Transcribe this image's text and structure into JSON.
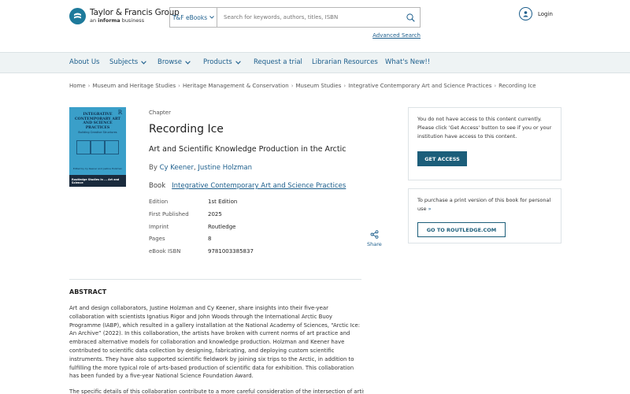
{
  "header": {
    "logo_main": "Taylor & Francis Group",
    "logo_sub_prefix": "an ",
    "logo_sub_bold": "informa",
    "logo_sub_suffix": " business",
    "search_scope": "T&F eBooks",
    "search_placeholder": "Search for keywords, authors, titles, ISBN",
    "advanced_search": "Advanced Search",
    "login": "Login"
  },
  "nav": {
    "items": [
      {
        "label": "About Us",
        "dropdown": false
      },
      {
        "label": "Subjects",
        "dropdown": true
      },
      {
        "label": "Browse",
        "dropdown": true
      },
      {
        "label": "Products",
        "dropdown": true
      },
      {
        "label": "Request a trial",
        "dropdown": false
      },
      {
        "label": "Librarian Resources",
        "dropdown": false
      },
      {
        "label": "What's New!!",
        "dropdown": false
      }
    ]
  },
  "breadcrumb": [
    "Home",
    "Museum and Heritage Studies",
    "Heritage Management & Conservation",
    "Museum Studies",
    "Integrative Contemporary Art and Science Practices",
    "Recording Ice"
  ],
  "cover": {
    "title_lines": [
      "INTEGRATIVE",
      "CONTEMPORARY ART",
      "AND SCIENCE PRACTICES"
    ],
    "subtitle": "Building Creative Structures",
    "editors": "Edited by Cy Keener and Justine Holzman",
    "series": "Routledge Studies in ... Art and Science"
  },
  "chapter": {
    "type": "Chapter",
    "title": "Recording Ice",
    "subtitle": "Art and Scientific Knowledge Production in the Arctic",
    "by": "By",
    "author1": "Cy Keener",
    "author2": "Justine Holzman",
    "book_label": "Book",
    "book_title": "Integrative Contemporary Art and Science Practices",
    "meta": [
      {
        "label": "Edition",
        "value": "1st Edition"
      },
      {
        "label": "First Published",
        "value": "2025"
      },
      {
        "label": "Imprint",
        "value": "Routledge"
      },
      {
        "label": "Pages",
        "value": "8"
      },
      {
        "label": "eBook ISBN",
        "value": "9781003385837"
      }
    ],
    "share": "Share"
  },
  "access": {
    "text": "You do not have access to this content currently. Please click 'Get Access' button to see if you or your institution have access to this content.",
    "button": "GET ACCESS"
  },
  "purchase": {
    "text": "To purchase a print version of this book for personal use",
    "button": "GO TO ROUTLEDGE.COM"
  },
  "abstract": {
    "heading": "ABSTRACT",
    "paragraph1": "Art and design collaborators, Justine Holzman and Cy Keener, share insights into their five-year collaboration with scientists Ignatius Rigor and John Woods through the International Arctic Buoy Programme (IABP), which resulted in a gallery installation at the National Academy of Sciences, “Arctic Ice: An Archive” (2022). In this collaboration, the artists have broken with current norms of art practice and embraced alternative models for collaboration and knowledge production. Holzman and Keener have contributed to scientific data collection by designing, fabricating, and deploying custom scientific instruments. They have also supported scientific fieldwork by joining six trips to the Arctic, in addition to fulfilling the more typical role of arts-based production of scientific data for exhibition. This collaboration has been funded by a five-year National Science Foundation Award.",
    "paragraph2": "The specific details of this collaboration contribute to a more careful consideration of the intersection of artistic"
  }
}
